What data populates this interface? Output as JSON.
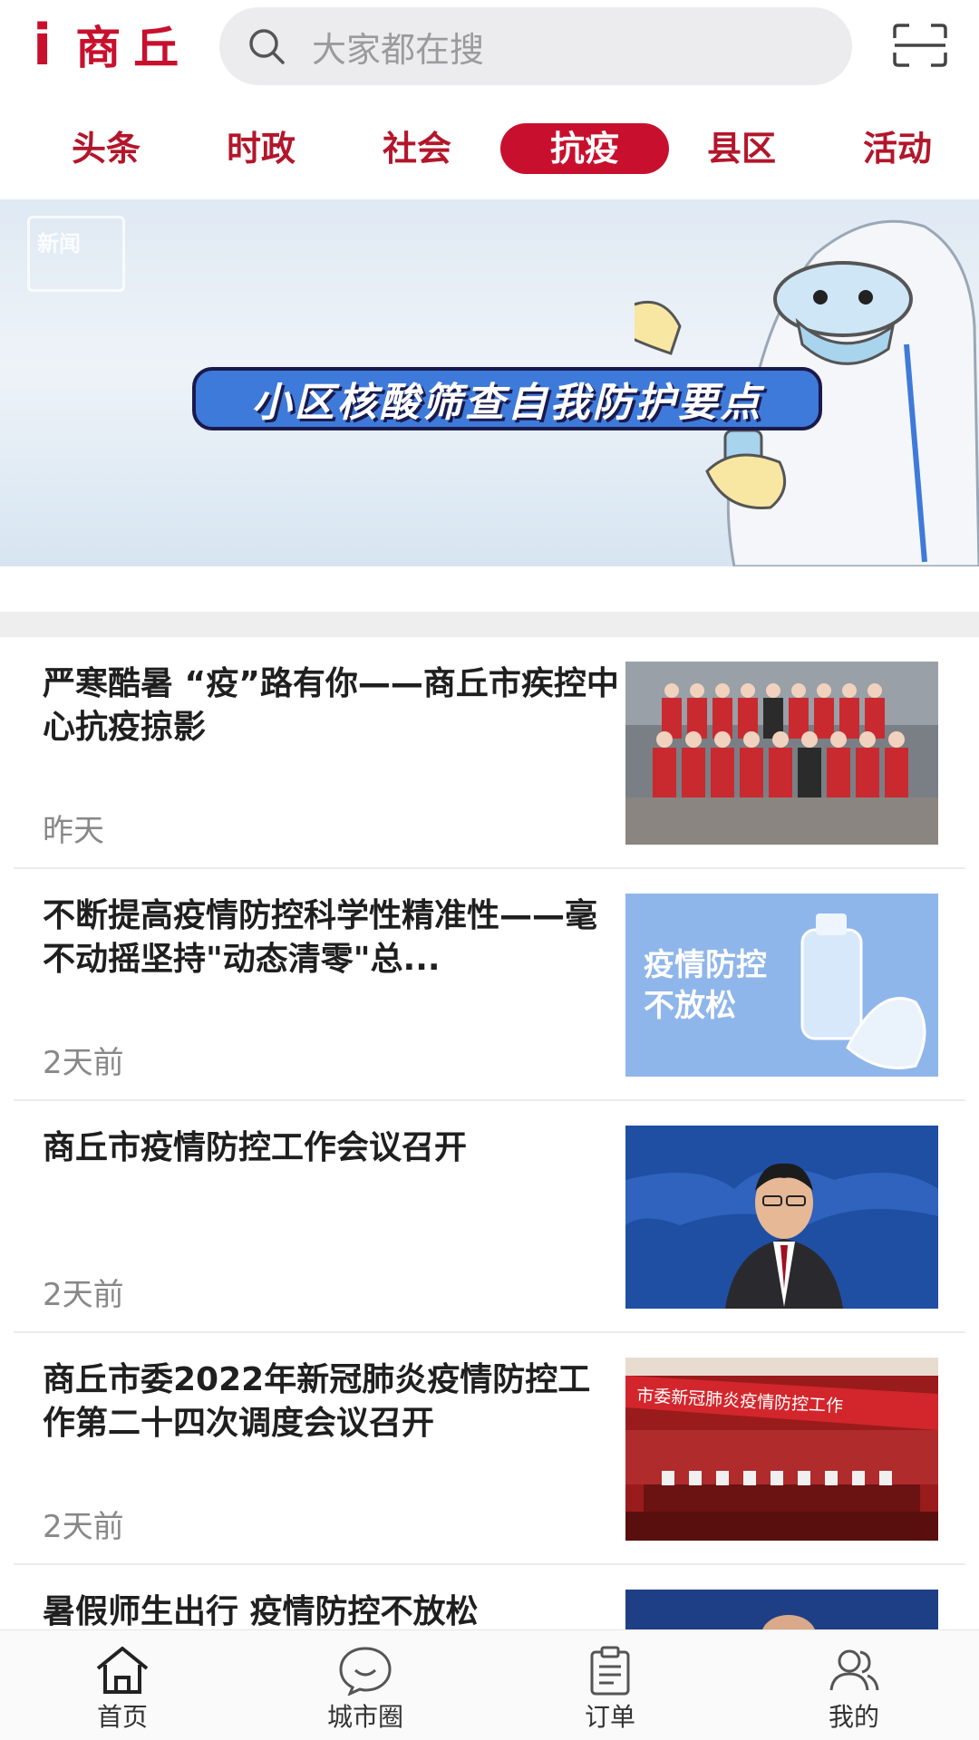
{
  "header": {
    "logo_i": "i",
    "logo_text": "商丘",
    "search_placeholder": "大家都在搜",
    "icons": {
      "search": "search-icon",
      "scan": "scan-icon"
    }
  },
  "tabs": [
    {
      "label": "头条",
      "active": false
    },
    {
      "label": "时政",
      "active": false
    },
    {
      "label": "社会",
      "active": false
    },
    {
      "label": "抗疫",
      "active": true
    },
    {
      "label": "县区",
      "active": false
    },
    {
      "label": "活动",
      "active": false
    }
  ],
  "banner": {
    "caption": "小区核酸筛查自我防护要点",
    "logo_text": "新闻"
  },
  "news": [
    {
      "title": "严寒酷暑 “疫”路有你——商丘市疾控中心抗疫掠影",
      "time": "昨天"
    },
    {
      "title": "不断提高疫情防控科学性精准性——毫不动摇坚持\"动态清零\"总...",
      "time": "2天前",
      "thumb_text": "疫情防控不放松"
    },
    {
      "title": "商丘市疫情防控工作会议召开",
      "time": "2天前"
    },
    {
      "title": "商丘市委2022年新冠肺炎疫情防控工作第二十四次调度会议召开",
      "time": "2天前",
      "thumb_text": "市委新冠肺炎疫情防控工作"
    },
    {
      "title": "暑假师生出行 疫情防控不放松",
      "time": ""
    }
  ],
  "bottom_nav": [
    {
      "label": "首页",
      "icon": "home-icon"
    },
    {
      "label": "城市圈",
      "icon": "chat-bubble-icon"
    },
    {
      "label": "订单",
      "icon": "clipboard-icon"
    },
    {
      "label": "我的",
      "icon": "users-icon"
    }
  ],
  "colors": {
    "brand": "#c8102e",
    "tab_text": "#b3162b",
    "muted": "#888888",
    "search_bg": "#ececef"
  }
}
